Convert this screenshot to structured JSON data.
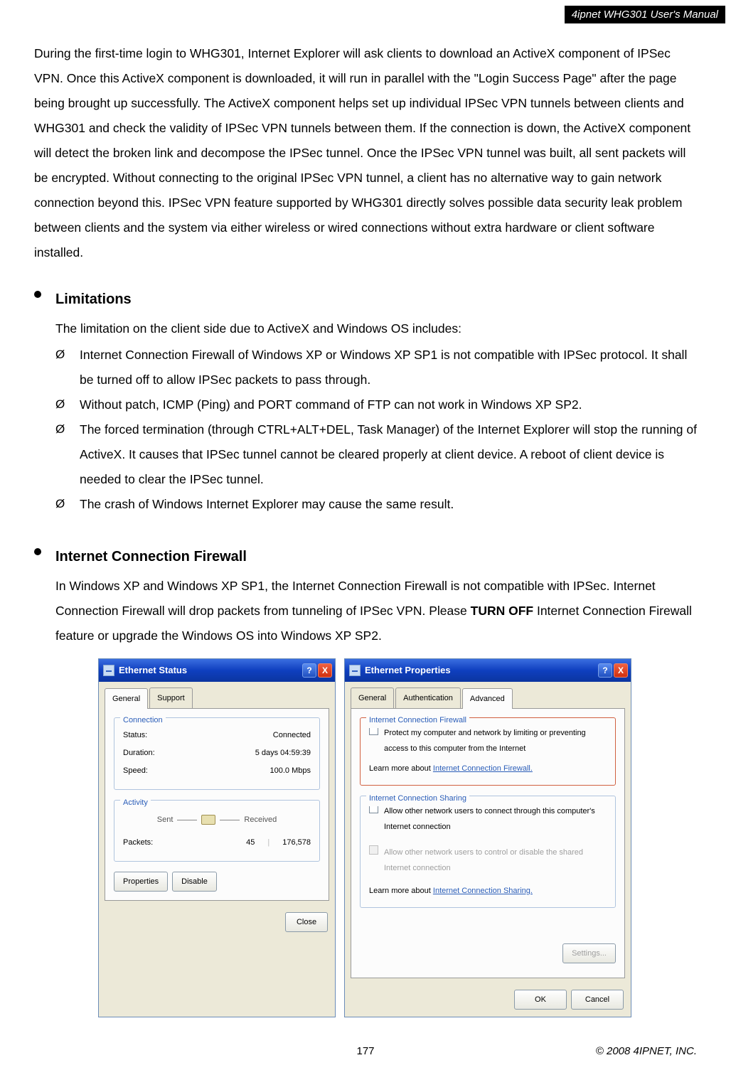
{
  "header": {
    "title": "4ipnet WHG301 User's Manual"
  },
  "intro_paragraph": "During the first-time login to WHG301, Internet Explorer will ask clients to download an ActiveX component of IPSec VPN. Once this ActiveX component is downloaded, it will run in parallel with the \"Login Success Page\" after the page being brought up successfully. The ActiveX component helps set up individual IPSec VPN tunnels between clients and WHG301 and check the validity of IPSec VPN tunnels between them. If the connection is down, the ActiveX component will detect the broken link and decompose the IPSec tunnel. Once the IPSec VPN tunnel was built, all sent packets will be encrypted. Without connecting to the original IPSec VPN tunnel, a client has no alternative way to gain network connection beyond this. IPSec VPN feature supported by WHG301 directly solves possible data security leak problem between clients and the system via either wireless or wired connections without extra hardware or client software installed.",
  "limitations": {
    "heading": "Limitations",
    "intro": "The limitation on the client side due to ActiveX and Windows OS includes:",
    "marker": "Ø",
    "items": [
      "Internet Connection Firewall of Windows XP or Windows XP SP1 is not compatible with IPSec protocol. It shall be turned off to allow IPSec packets to pass through.",
      "Without patch, ICMP (Ping) and PORT command of FTP can not work in Windows XP SP2.",
      "The forced termination (through CTRL+ALT+DEL, Task Manager) of the Internet Explorer will stop the running of ActiveX. It causes that IPSec tunnel cannot be cleared properly at client device. A reboot of client device is needed to clear the IPSec tunnel.",
      "The crash of Windows Internet Explorer may cause the same result."
    ]
  },
  "icf": {
    "heading": "Internet Connection Firewall",
    "para_pre": "In Windows XP and Windows XP SP1, the Internet Connection Firewall is not compatible with IPSec. Internet Connection Firewall will drop packets from tunneling of IPSec VPN. Please ",
    "para_bold": "TURN OFF",
    "para_post": " Internet Connection Firewall feature or upgrade the Windows OS into Windows XP SP2."
  },
  "dialog_status": {
    "title": "Ethernet Status",
    "help": "?",
    "close": "X",
    "tabs": [
      "General",
      "Support"
    ],
    "group_conn": {
      "title": "Connection",
      "rows": [
        {
          "label": "Status:",
          "value": "Connected"
        },
        {
          "label": "Duration:",
          "value": "5 days 04:59:39"
        },
        {
          "label": "Speed:",
          "value": "100.0 Mbps"
        }
      ]
    },
    "group_act": {
      "title": "Activity",
      "sent_label": "Sent",
      "recv_label": "Received",
      "packets_label": "Packets:",
      "sent_value": "45",
      "recv_value": "176,578"
    },
    "buttons": {
      "properties": "Properties",
      "disable": "Disable",
      "close": "Close"
    }
  },
  "dialog_props": {
    "title": "Ethernet Properties",
    "help": "?",
    "close": "X",
    "tabs": [
      "General",
      "Authentication",
      "Advanced"
    ],
    "group_icf": {
      "title": "Internet Connection Firewall",
      "check_label": "Protect my computer and network by limiting or preventing access to this computer from the Internet",
      "learn_prefix": "Learn more about ",
      "learn_link": "Internet Connection Firewall."
    },
    "group_ics": {
      "title": "Internet Connection Sharing",
      "check1": "Allow other network users to connect through this computer's Internet connection",
      "check2": "Allow other network users to control or disable the shared Internet connection",
      "learn_prefix": "Learn more about ",
      "learn_link": "Internet Connection Sharing."
    },
    "settings_btn": "Settings...",
    "ok": "OK",
    "cancel": "Cancel"
  },
  "footer": {
    "page": "177",
    "copyright": "© 2008 4IPNET, INC."
  }
}
